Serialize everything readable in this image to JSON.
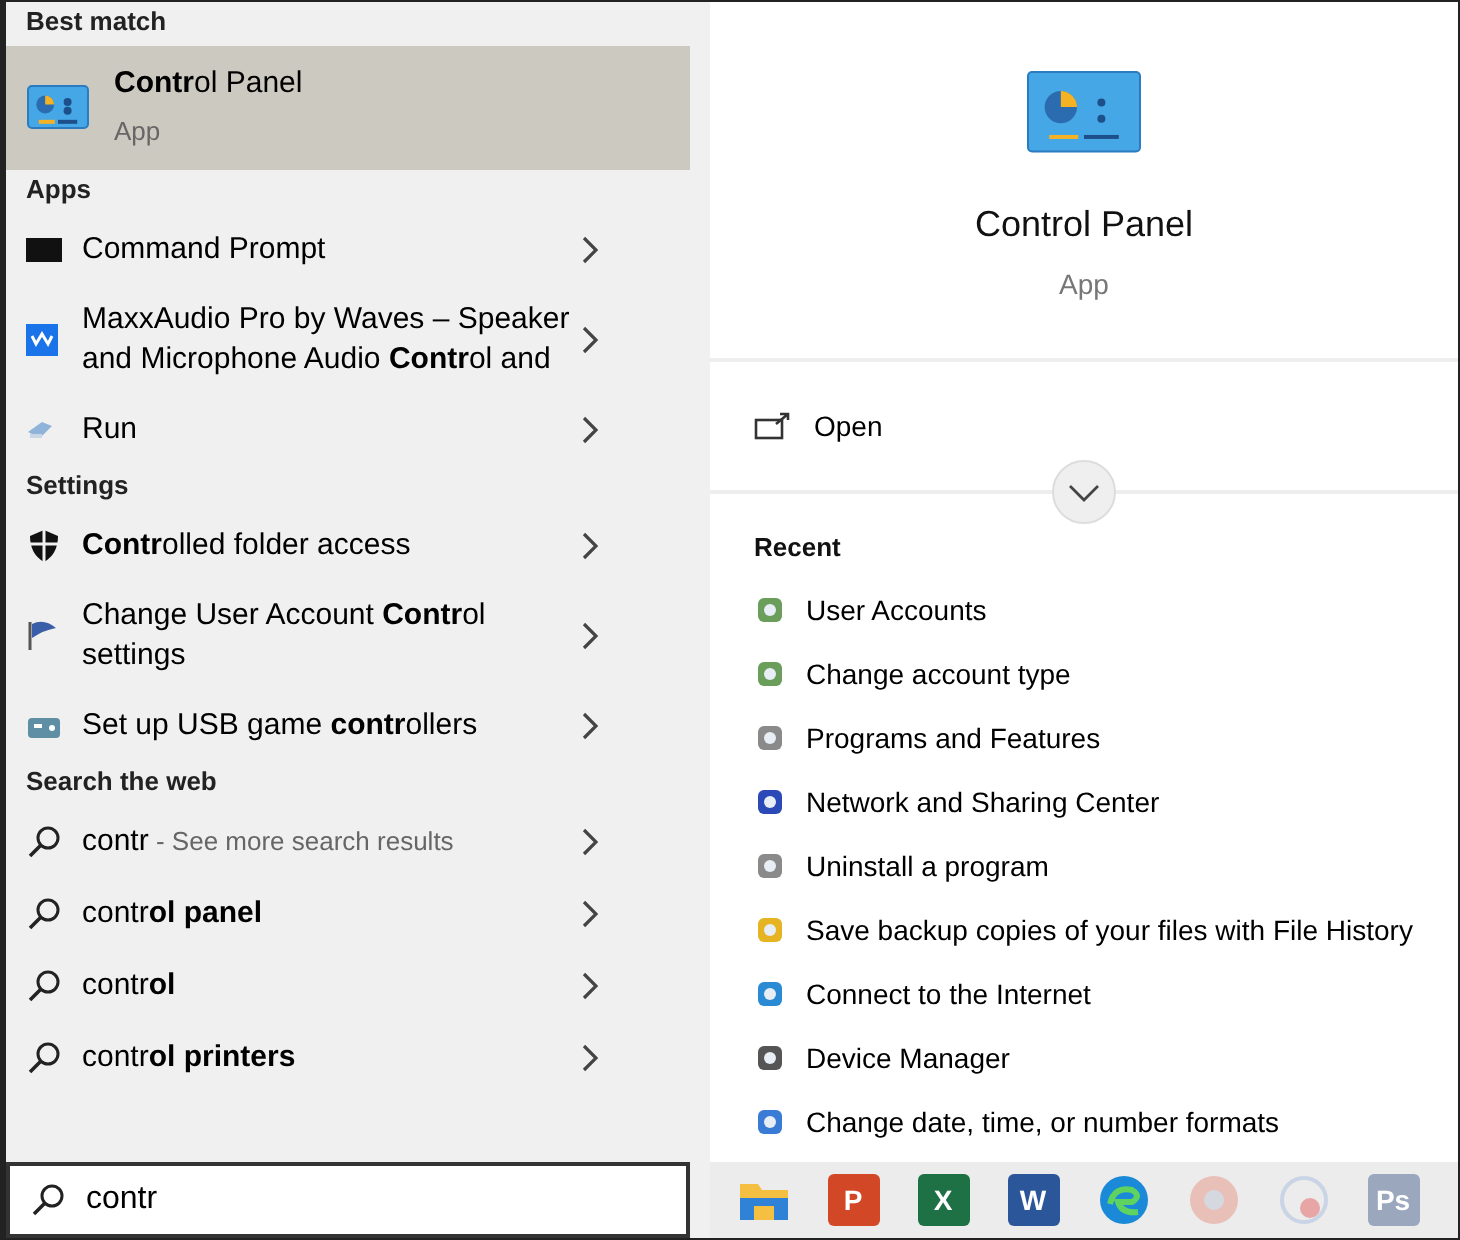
{
  "results": [
    {
      "heading": "Best match",
      "kind": "best",
      "items": [
        {
          "text": "**Contr**ol Panel",
          "subtitle": "App",
          "selected": true
        }
      ]
    },
    {
      "heading": "Apps",
      "kind": "app",
      "items": [
        {
          "text": "Command Prompt",
          "selected": false
        },
        {
          "text": "MaxxAudio Pro by Waves – Speaker and Microphone Audio **Contr**ol and",
          "selected": false
        },
        {
          "text": "Run",
          "selected": false
        }
      ]
    },
    {
      "heading": "Settings",
      "kind": "setting",
      "items": [
        {
          "text": "**Contr**olled folder access",
          "selected": false
        },
        {
          "text": "Change User Account **Contr**ol settings",
          "selected": false
        },
        {
          "text": "Set up USB game **contr**ollers",
          "selected": false
        }
      ]
    },
    {
      "heading": "Search the web",
      "kind": "web",
      "items": [
        {
          "text": "contr",
          "hint": "- See more search results",
          "selected": false
        },
        {
          "text": "contr**ol panel**",
          "selected": false
        },
        {
          "text": "contr**ol**",
          "selected": false
        },
        {
          "text": "contr**ol printers**",
          "selected": false
        }
      ]
    }
  ],
  "search_box": {
    "value": "contr"
  },
  "detail": {
    "title": "Control Panel",
    "subtitle": "App",
    "action": "Open",
    "recent_heading": "Recent",
    "recent": [
      "User Accounts",
      "Change account type",
      "Programs and Features",
      "Network and Sharing Center",
      "Uninstall a program",
      "Save backup copies of your files with File History",
      "Connect to the Internet",
      "Device Manager",
      "Change date, time, or number formats"
    ]
  },
  "taskbar": [
    {
      "kind": "folder"
    },
    {
      "kind": "office",
      "label": "P",
      "color": "#d24726"
    },
    {
      "kind": "office",
      "label": "X",
      "color": "#1e7145"
    },
    {
      "kind": "office",
      "label": "W",
      "color": "#2b579a"
    },
    {
      "kind": "edge"
    },
    {
      "kind": "chrome"
    },
    {
      "kind": "media"
    },
    {
      "kind": "office",
      "label": "Ps",
      "color": "#9aa7bd"
    }
  ]
}
